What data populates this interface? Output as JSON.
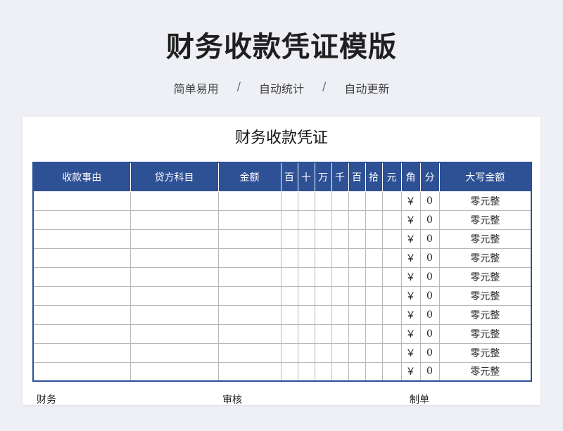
{
  "hero": {
    "title": "财务收款凭证模版",
    "features": [
      "简单易用",
      "自动统计",
      "自动更新"
    ],
    "separator": "/"
  },
  "document": {
    "title": "财务收款凭证",
    "columns": [
      "收款事由",
      "贷方科目",
      "金额",
      "百",
      "十",
      "万",
      "千",
      "百",
      "拾",
      "元",
      "角",
      "分",
      "大写金额"
    ],
    "currency_symbol": "￥",
    "rows": [
      {
        "jiao": "0",
        "daxie": "零元整"
      },
      {
        "jiao": "0",
        "daxie": "零元整"
      },
      {
        "jiao": "0",
        "daxie": "零元整"
      },
      {
        "jiao": "0",
        "daxie": "零元整"
      },
      {
        "jiao": "0",
        "daxie": "零元整"
      },
      {
        "jiao": "0",
        "daxie": "零元整"
      },
      {
        "jiao": "0",
        "daxie": "零元整"
      },
      {
        "jiao": "0",
        "daxie": "零元整"
      },
      {
        "jiao": "0",
        "daxie": "零元整"
      },
      {
        "jiao": "0",
        "daxie": "零元整"
      }
    ],
    "footer": [
      "财务",
      "审核",
      "制单"
    ]
  },
  "colors": {
    "header_bg": "#2e5095",
    "page_bg": "#eef0f5"
  }
}
